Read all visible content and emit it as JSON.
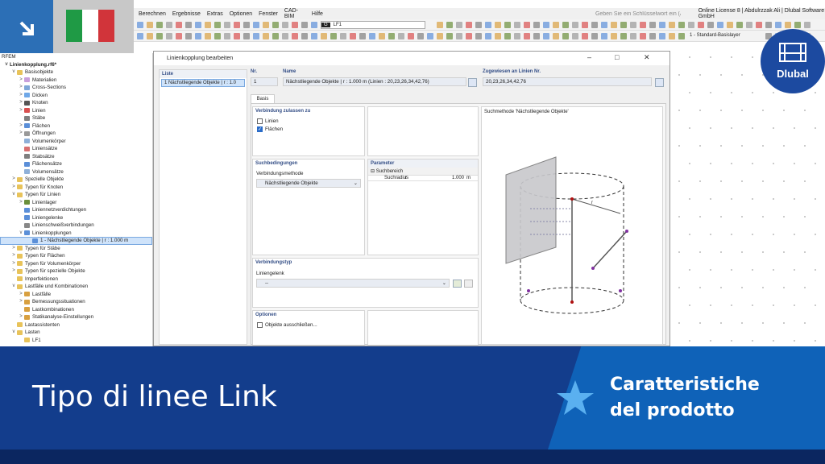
{
  "menu": [
    "Berechnen",
    "Ergebnisse",
    "Extras",
    "Optionen",
    "Fenster",
    "CAD-BIM",
    "Hilfe"
  ],
  "search_placeholder": "Geben Sie ein Schlüsselwort ein (Alt...",
  "license": "Online License 8 | Abdulrzzak Ali | Dlubal Software GmbH",
  "loadcase": "LF1",
  "lc_tag": "G",
  "layer": "1 - Standard-Basislayer",
  "nav": {
    "root": "RFEM",
    "file": "Linienkopplung.rf6*",
    "items": [
      {
        "label": "Basisobjekte",
        "level": 1,
        "ex": "v",
        "c": "#e8c35a"
      },
      {
        "label": "Materialien",
        "level": 2,
        "ex": ">",
        "c": "#c9a0dc"
      },
      {
        "label": "Cross-Sections",
        "level": 2,
        "ex": ">",
        "c": "#7fa7d8"
      },
      {
        "label": "Dicken",
        "level": 2,
        "ex": ">",
        "c": "#6fa8e8"
      },
      {
        "label": "Knoten",
        "level": 2,
        "ex": ">",
        "c": "#555"
      },
      {
        "label": "Linien",
        "level": 2,
        "ex": ">",
        "c": "#d85050"
      },
      {
        "label": "Stäbe",
        "level": 2,
        "ex": "",
        "c": "#7f7f7f"
      },
      {
        "label": "Flächen",
        "level": 2,
        "ex": ">",
        "c": "#5b8fd8"
      },
      {
        "label": "Öffnungen",
        "level": 2,
        "ex": ">",
        "c": "#999"
      },
      {
        "label": "Volumenkörper",
        "level": 2,
        "ex": "",
        "c": "#8fb0d8"
      },
      {
        "label": "Liniensätze",
        "level": 2,
        "ex": "",
        "c": "#d87070"
      },
      {
        "label": "Stabsätze",
        "level": 2,
        "ex": "",
        "c": "#7f7f7f"
      },
      {
        "label": "Flächensätze",
        "level": 2,
        "ex": "",
        "c": "#5b8fd8"
      },
      {
        "label": "Volumensätze",
        "level": 2,
        "ex": "",
        "c": "#8fb0d8"
      },
      {
        "label": "Spezielle Objekte",
        "level": 1,
        "ex": ">",
        "c": "#e8c35a"
      },
      {
        "label": "Typen für Knoten",
        "level": 1,
        "ex": ">",
        "c": "#e8c35a"
      },
      {
        "label": "Typen für Linien",
        "level": 1,
        "ex": "v",
        "c": "#e8c35a"
      },
      {
        "label": "Linienlager",
        "level": 2,
        "ex": ">",
        "c": "#6a8f3a"
      },
      {
        "label": "Liniennetzverdichtungen",
        "level": 2,
        "ex": "",
        "c": "#5b8fd8"
      },
      {
        "label": "Liniengelenke",
        "level": 2,
        "ex": "",
        "c": "#5b8fd8"
      },
      {
        "label": "Linienschweißverbindungen",
        "level": 2,
        "ex": "",
        "c": "#888"
      },
      {
        "label": "Linienkopplungen",
        "level": 2,
        "ex": "v",
        "c": "#5b8fd8"
      },
      {
        "label": "1 - Nächstliegende Objekte | r : 1.000 m",
        "level": 3,
        "ex": "",
        "c": "#5b8fd8",
        "sel": true
      },
      {
        "label": "Typen für Stäbe",
        "level": 1,
        "ex": ">",
        "c": "#e8c35a"
      },
      {
        "label": "Typen für Flächen",
        "level": 1,
        "ex": ">",
        "c": "#e8c35a"
      },
      {
        "label": "Typen für Volumenkörper",
        "level": 1,
        "ex": ">",
        "c": "#e8c35a"
      },
      {
        "label": "Typen für spezielle Objekte",
        "level": 1,
        "ex": ">",
        "c": "#e8c35a"
      },
      {
        "label": "Imperfektionen",
        "level": 1,
        "ex": "",
        "c": "#e8c35a"
      },
      {
        "label": "Lastfälle und Kombinationen",
        "level": 1,
        "ex": "v",
        "c": "#e8c35a"
      },
      {
        "label": "Lastfälle",
        "level": 2,
        "ex": ">",
        "c": "#d8a040"
      },
      {
        "label": "Bemessungssituationen",
        "level": 2,
        "ex": ">",
        "c": "#d8a040"
      },
      {
        "label": "Lastkombinationen",
        "level": 2,
        "ex": "",
        "c": "#d8a040"
      },
      {
        "label": "Statikanalyse-Einstellungen",
        "level": 2,
        "ex": ">",
        "c": "#d8a040"
      },
      {
        "label": "Lastassistenten",
        "level": 1,
        "ex": "",
        "c": "#e8c35a"
      },
      {
        "label": "Lasten",
        "level": 1,
        "ex": "v",
        "c": "#e8c35a"
      },
      {
        "label": "LF1",
        "level": 2,
        "ex": "",
        "c": "#e8c35a"
      }
    ]
  },
  "dialog": {
    "title": "Linienkopplung bearbeiten",
    "list_label": "Liste",
    "list_item": "1  Nächstliegende Objekte | r : 1.0",
    "nr_label": "Nr.",
    "nr_value": "1",
    "name_label": "Name",
    "name_value": "Nächstliegende Objekte | r : 1.000 m (Linien : 20,23,26,34,42,76)",
    "assigned_label": "Zugewiesen an Linien Nr.",
    "assigned_value": "20,23,26,34,42,76",
    "tab": "Basis",
    "verbindung_title": "Verbindung zulassen zu",
    "cb_linien": "Linien",
    "cb_flaechen": "Flächen",
    "such_title": "Suchbedingungen",
    "methode_label": "Verbindungsmethode",
    "methode_value": "Nächstliegende Objekte",
    "param_title": "Parameter",
    "param_group": "Suchbereich",
    "param_name": "Suchradius",
    "param_sym": "r",
    "param_val": "1.000",
    "param_unit": "m",
    "typ_title": "Verbindungstyp",
    "gelenk_label": "Liniengelenk",
    "gelenk_value": "--",
    "optionen_title": "Optionen",
    "cb_ausschl": "Objekte ausschließen...",
    "preview_title": "Suchmethode 'Nächstliegende Objekte'",
    "preview_r": "r"
  },
  "banner": {
    "title": "Tipo di linee Link",
    "sub1": "Caratteristiche",
    "sub2": "del prodotto"
  },
  "logo_text": "Dlubal"
}
